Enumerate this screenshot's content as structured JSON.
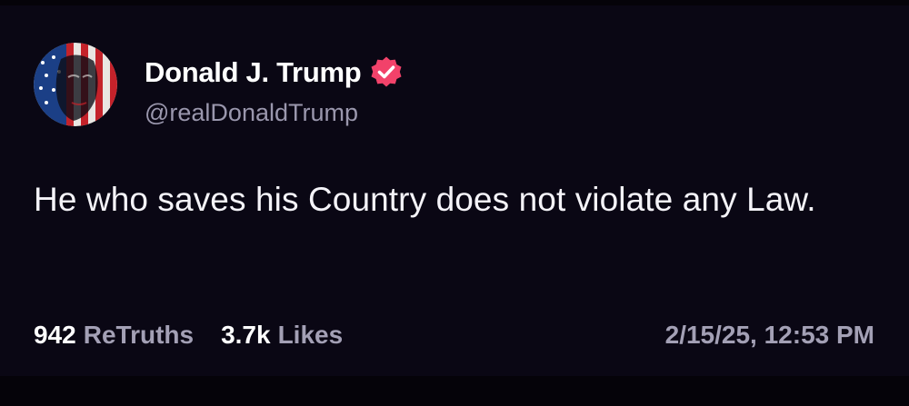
{
  "post": {
    "author": {
      "display_name": "Donald J. Trump",
      "handle": "@realDonaldTrump",
      "verified": true,
      "avatar_icon": "flag-face-avatar",
      "verified_icon": "verified-badge-icon"
    },
    "text": "He who saves his Country does not violate any Law.",
    "stats": {
      "retruths_count": "942",
      "retruths_label": "ReTruths",
      "likes_count": "3.7k",
      "likes_label": "Likes"
    },
    "timestamp": "2/15/25, 12:53 PM"
  },
  "colors": {
    "background": "#0a0714",
    "verified_badge": "#f2426a",
    "text_primary": "#ffffff",
    "text_secondary": "#a3a0b5"
  }
}
